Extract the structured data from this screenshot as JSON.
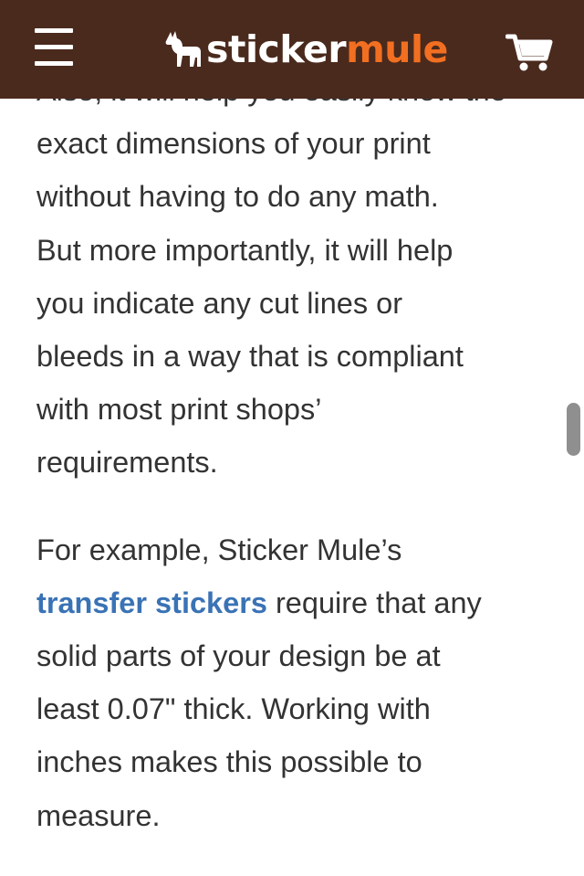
{
  "header": {
    "menu_icon": "hamburger-menu-icon",
    "logo": {
      "part1": "sticker",
      "part2": "mule",
      "icon": "mule-icon",
      "colors": {
        "sticker": "#ffffff",
        "mule": "#f26f21"
      }
    },
    "cart_icon": "shopping-cart-icon",
    "background": "#4a2a1d"
  },
  "article": {
    "partial_line": "Also, it will help you easily know the",
    "paragraph1": [
      "exact dimensions of your print",
      "without having to do any math.",
      "But more importantly, it will help",
      "you indicate any cut lines or",
      "bleeds in a way that is compliant",
      "with most print shops’",
      "requirements."
    ],
    "paragraph2": {
      "line1": "For example, Sticker Mule’s",
      "link_text": "transfer stickers",
      "after_link": " require that any",
      "line3": "solid parts of your design be at",
      "line4": "least 0.07\" thick. Working with",
      "line5": "inches makes this possible to",
      "line6": "measure."
    },
    "link_color": "#3a73b5"
  }
}
